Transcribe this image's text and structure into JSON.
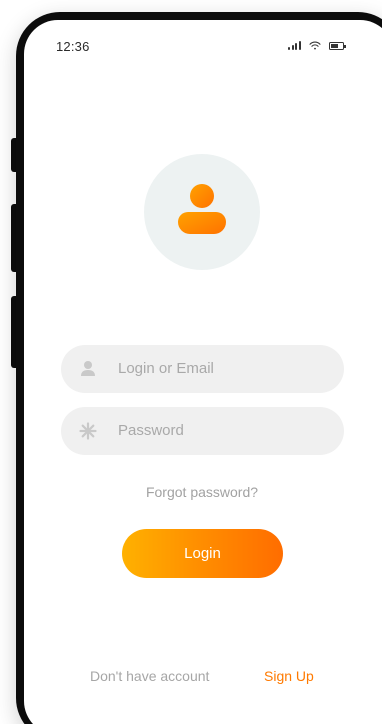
{
  "status_bar": {
    "time": "12:36"
  },
  "avatar": {
    "icon": "user-icon",
    "circle_color": "#edf2f2",
    "icon_color": "#ff8a00"
  },
  "login_field": {
    "placeholder": "Login or Email",
    "icon": "user-icon"
  },
  "password_field": {
    "placeholder": "Password",
    "icon": "asterisk-icon"
  },
  "forgot_link": "Forgot password?",
  "login_button": {
    "label": "Login",
    "gradient": [
      "#ffb100",
      "#ff6d00"
    ]
  },
  "footer": {
    "prompt": "Don't have account",
    "signup_label": "Sign Up",
    "signup_color": "#ff7a00"
  }
}
